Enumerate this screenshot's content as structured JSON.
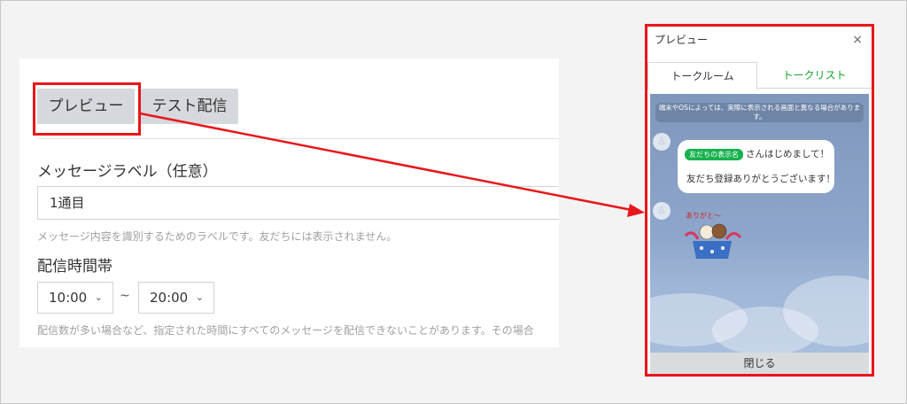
{
  "form": {
    "tabs": {
      "preview": "プレビュー",
      "test": "テスト配信"
    },
    "message_label": {
      "label": "メッセージラベル（任意）",
      "value": "1通目",
      "hint": "メッセージ内容を識別するためのラベルです。友だちには表示されません。"
    },
    "delivery_time": {
      "label": "配信時間帯",
      "from": "10:00",
      "separator": "~",
      "to": "20:00",
      "hint": "配信数が多い場合など、指定された時間にすべてのメッセージを配信できないことがあります。その場合"
    }
  },
  "preview_modal": {
    "title": "プレビュー",
    "close": "×",
    "tabs": {
      "talk_room": "トークルーム",
      "talk_list": "トークリスト"
    },
    "notice": "端末やOSによっては、実際に表示される画面と異なる場合があります。",
    "message": {
      "name_badge": "友だちの表示名",
      "line1_suffix": "さんはじめまして！",
      "line2": "友だち登録ありがとうございます！"
    },
    "sticker_text": "ありがと～",
    "close_button": "閉じる"
  },
  "colors": {
    "highlight_red": "#e8161b",
    "line_green": "#10a52b",
    "chat_bg": "#8ea6cb"
  }
}
